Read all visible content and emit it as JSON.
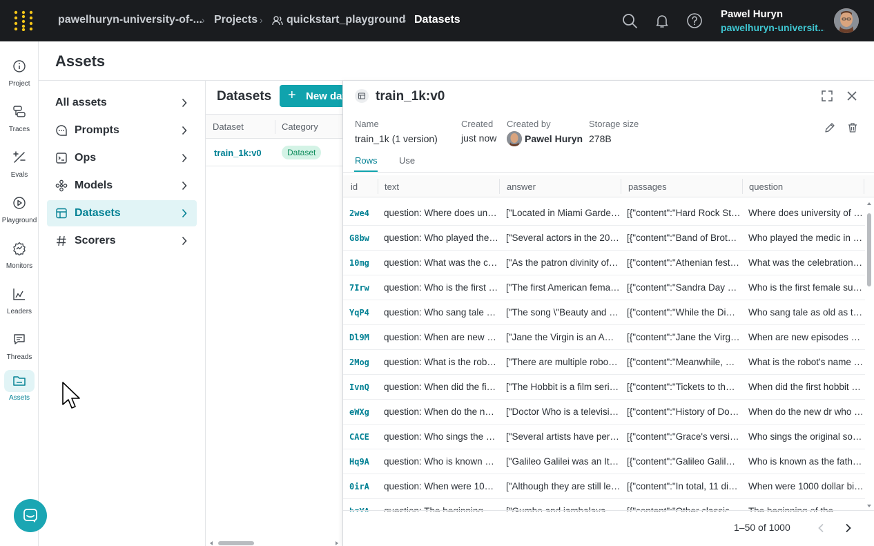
{
  "topbar": {
    "breadcrumbs": [
      {
        "label": "pawelhuryn-university-of-..."
      },
      {
        "label": "Projects"
      },
      {
        "label": "quickstart_playground"
      },
      {
        "label": "Datasets"
      }
    ],
    "user": {
      "name": "Pawel Huryn",
      "org": "pawelhuryn-universit..."
    }
  },
  "rail": {
    "items": [
      {
        "label": "Project",
        "icon": "info-icon"
      },
      {
        "label": "Traces",
        "icon": "traces-icon"
      },
      {
        "label": "Evals",
        "icon": "evals-icon"
      },
      {
        "label": "Playground",
        "icon": "play-icon"
      },
      {
        "label": "Monitors",
        "icon": "monitor-icon"
      },
      {
        "label": "Leaders",
        "icon": "leaderboard-icon"
      },
      {
        "label": "Threads",
        "icon": "threads-icon"
      },
      {
        "label": "Assets",
        "icon": "folder-icon",
        "active": true
      }
    ]
  },
  "page": {
    "title": "Assets"
  },
  "assets_nav": {
    "items": [
      {
        "label": "All assets"
      },
      {
        "label": "Prompts",
        "icon": "chat-bubble-icon"
      },
      {
        "label": "Ops",
        "icon": "code-icon"
      },
      {
        "label": "Models",
        "icon": "model-icon"
      },
      {
        "label": "Datasets",
        "icon": "table-icon",
        "active": true
      },
      {
        "label": "Scorers",
        "icon": "hash-icon"
      }
    ]
  },
  "datasets_pane": {
    "title": "Datasets",
    "new_button": "New dat",
    "columns": [
      "Dataset",
      "Category"
    ],
    "rows": [
      {
        "name": "train_1k:v0",
        "category": "Dataset"
      }
    ]
  },
  "drawer": {
    "title": "train_1k:v0",
    "meta": {
      "name_label": "Name",
      "name_value": "train_1k (1 version)",
      "created_label": "Created",
      "created_value": "just now",
      "created_by_label": "Created by",
      "created_by_value": "Pawel Huryn",
      "size_label": "Storage size",
      "size_value": "278B"
    },
    "tabs": [
      "Rows",
      "Use"
    ],
    "columns": [
      "id",
      "text",
      "answer",
      "passages",
      "question"
    ],
    "rows": [
      {
        "id": "2we4",
        "text": "question: Where does uni…",
        "answer": "[\"Located in Miami Garde…",
        "passages": "[{\"content\":\"Hard Rock St…",
        "question": "Where does university of …"
      },
      {
        "id": "G8bw",
        "text": "question: Who played the…",
        "answer": "[\"Several actors in the 20…",
        "passages": "[{\"content\":\"Band of Brot…",
        "question": "Who played the medic in …"
      },
      {
        "id": "10mg",
        "text": "question: What was the c…",
        "answer": "[\"As the patron divinity of…",
        "passages": "[{\"content\":\"Athenian fest…",
        "question": "What was the celebration …"
      },
      {
        "id": "7Irw",
        "text": "question: Who is the first f…",
        "answer": "[\"The first American fema…",
        "passages": "[{\"content\":\"Sandra Day …",
        "question": "Who is the first female su…"
      },
      {
        "id": "YqP4",
        "text": "question: Who sang tale a…",
        "answer": "[\"The song \\\"Beauty and t…",
        "passages": "[{\"content\":\"While the Di…",
        "question": "Who sang tale as old as ti…"
      },
      {
        "id": "Dl9M",
        "text": "question: When are new e…",
        "answer": "[\"Jane the Virgin is an Am…",
        "passages": "[{\"content\":\"Jane the Virg…",
        "question": "When are new episodes o…"
      },
      {
        "id": "2Mog",
        "text": "question: What is the rob…",
        "answer": "[\"There are multiple robo…",
        "passages": "[{\"content\":\"Meanwhile, …",
        "question": "What is the robot's name …"
      },
      {
        "id": "IvnQ",
        "text": "question: When did the fir…",
        "answer": "[\"The Hobbit is a film seri…",
        "passages": "[{\"content\":\"Tickets to th…",
        "question": "When did the first hobbit …"
      },
      {
        "id": "eWXg",
        "text": "question: When do the ne…",
        "answer": "[\"Doctor Who is a televisi…",
        "passages": "[{\"content\":\"History of Do…",
        "question": "When do the new dr who …"
      },
      {
        "id": "CACE",
        "text": "question: Who sings the o…",
        "answer": "[\"Several artists have perf…",
        "passages": "[{\"content\":\"Grace's versi…",
        "question": "Who sings the original so…"
      },
      {
        "id": "Hq9A",
        "text": "question: Who is known a…",
        "answer": "[\"Galileo Galilei was an It…",
        "passages": "[{\"content\":\"Galileo Galil…",
        "question": "Who is known as the fath…"
      },
      {
        "id": "0irA",
        "text": "question: When were 100…",
        "answer": "[\"Although they are still le…",
        "passages": "[{\"content\":\"In total, 11 di…",
        "question": "When were 1000 dollar bil…"
      },
      {
        "id": "bzYA",
        "text": "question: The beginning…",
        "answer": "[\"Gumbo and jambalaya…",
        "passages": "[{\"content\":\"Other classic…",
        "question": "The beginning of the…"
      }
    ],
    "pager": "1–50 of 1000"
  }
}
